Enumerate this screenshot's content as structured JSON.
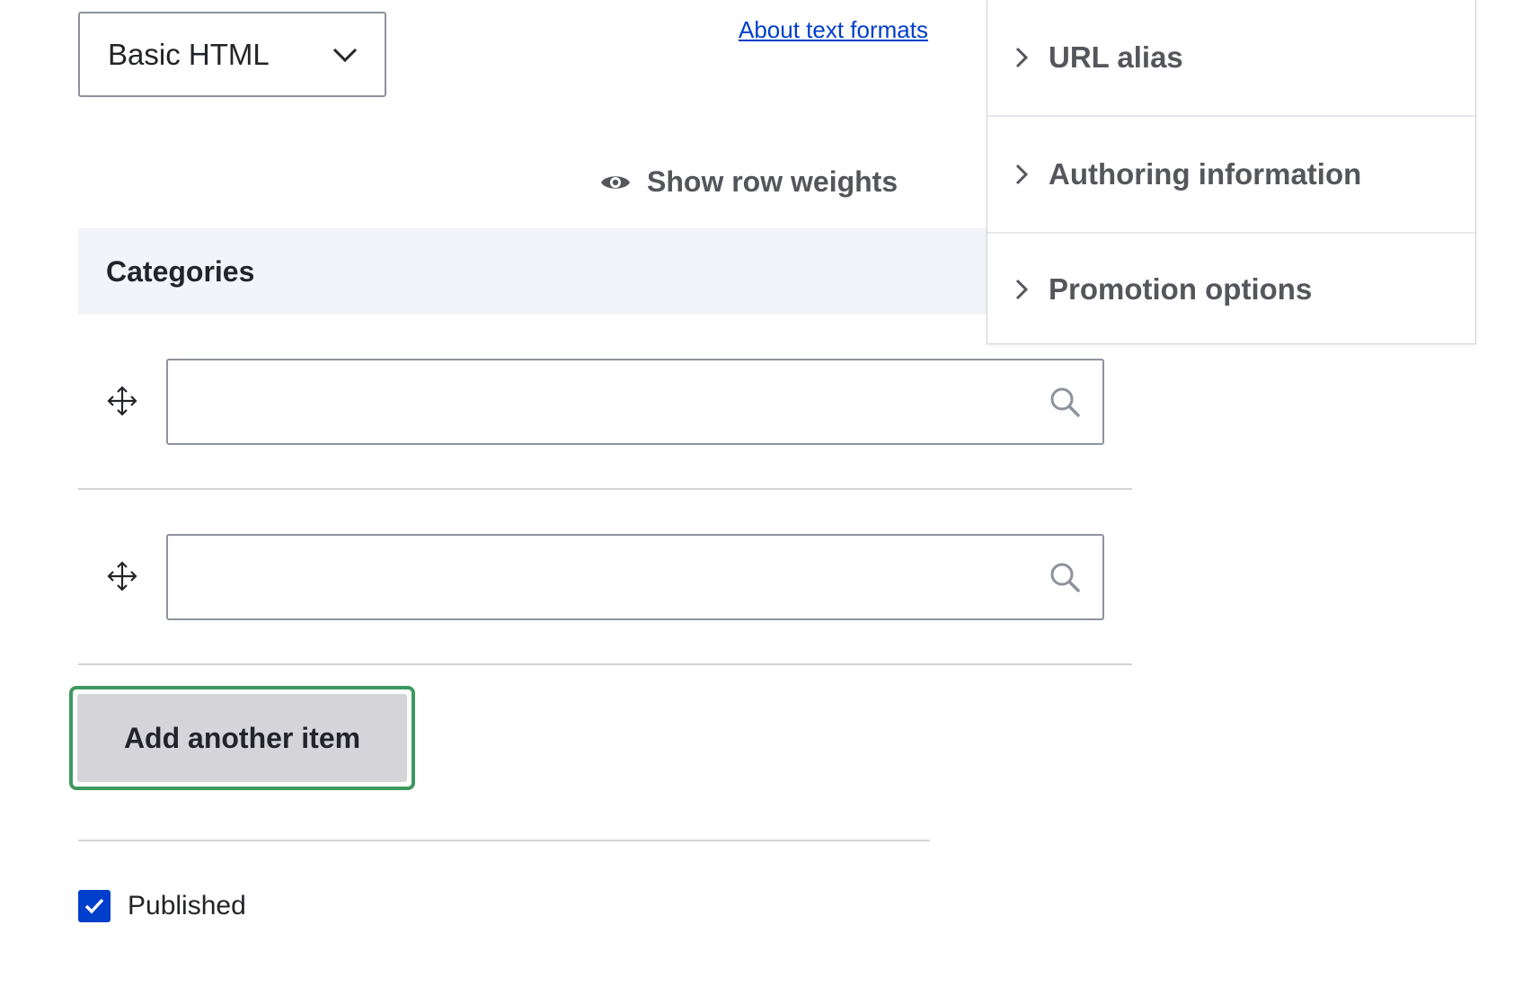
{
  "text_format": {
    "selected": "Basic HTML",
    "about_link": "About text formats"
  },
  "row_weights": {
    "label": "Show row weights"
  },
  "categories": {
    "heading": "Categories",
    "rows": [
      {
        "value": ""
      },
      {
        "value": ""
      }
    ],
    "add_button": "Add another item"
  },
  "sidebar": {
    "items": [
      {
        "label": "URL alias"
      },
      {
        "label": "Authoring information"
      },
      {
        "label": "Promotion options"
      }
    ]
  },
  "published": {
    "label": "Published",
    "checked": true
  },
  "colors": {
    "link": "#003ecc",
    "focus_ring": "#3f9960",
    "checkbox": "#003ecc",
    "header_bg": "#f3f4f9",
    "button_bg": "#d4d4d9"
  },
  "icons": [
    "chevron-down-icon",
    "eye-icon",
    "chevron-right-icon",
    "drag-handle-icon",
    "search-icon",
    "checkmark-icon"
  ]
}
